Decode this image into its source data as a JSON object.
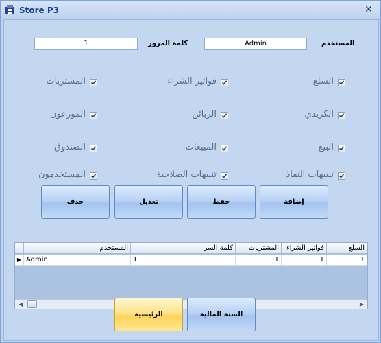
{
  "window": {
    "title": "Store P3",
    "close_glyph": "✕"
  },
  "login": {
    "user_label": "المستخدم",
    "user_value": "Admin",
    "password_label": "كلمة المرور",
    "password_value": "1"
  },
  "permissions": [
    {
      "label": "السلع",
      "checked": true
    },
    {
      "label": "فواتير الشراء",
      "checked": true
    },
    {
      "label": "المشتريات",
      "checked": true
    },
    {
      "label": "الكريدي",
      "checked": true
    },
    {
      "label": "الزبائن",
      "checked": true
    },
    {
      "label": "الموزعون",
      "checked": true
    },
    {
      "label": "البيع",
      "checked": true
    },
    {
      "label": "المبيعات",
      "checked": true
    },
    {
      "label": "الصندوق",
      "checked": true
    },
    {
      "label": "تنبيهات النفاذ",
      "checked": true
    },
    {
      "label": "تنبيهات الصلاحية",
      "checked": true
    },
    {
      "label": "المستخدمون",
      "checked": true
    }
  ],
  "actions": {
    "add": "إضافة",
    "save": "حفظ",
    "edit": "تعديل",
    "delete": "حذف"
  },
  "grid": {
    "columns": [
      "السلع",
      "فواتير الشراء",
      "المشتريات",
      "كلمة السر",
      "المستخدم"
    ],
    "rows": [
      {
        "col1": "1",
        "col2": "1",
        "col3": "1",
        "password": "1",
        "user": "Admin"
      }
    ],
    "row_indicator": "▶"
  },
  "footer": {
    "fiscal_year": "السنة المالية",
    "home": "الرئيسية"
  },
  "colors": {
    "accent_blue": "#a3c3ee",
    "gold": "#ffd45a",
    "title_text": "#15428b"
  }
}
